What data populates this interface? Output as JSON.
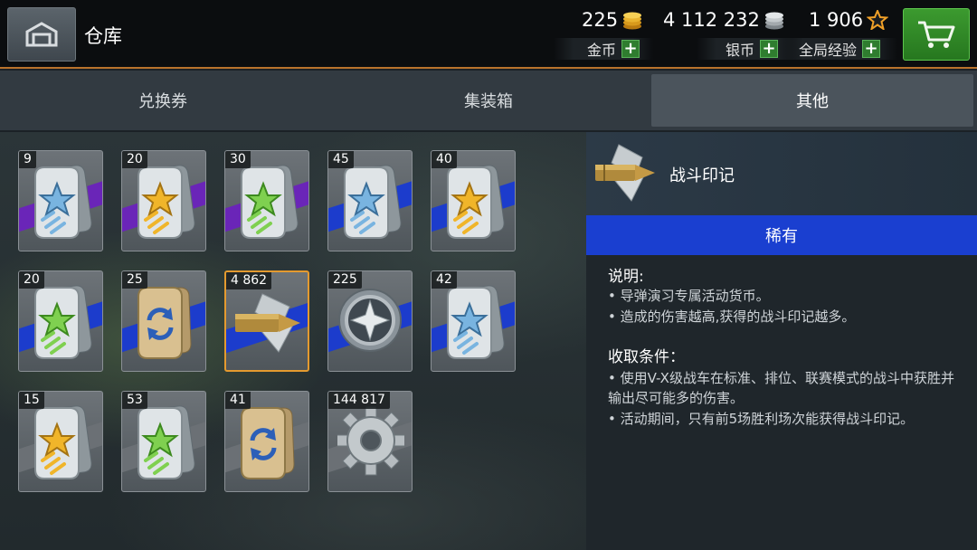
{
  "header": {
    "title": "仓库",
    "gold": {
      "value": "225",
      "label": "金币"
    },
    "silver": {
      "value": "4 112 232",
      "label": "银币"
    },
    "xp": {
      "value": "1 906",
      "label": "全局经验"
    },
    "plus": "+"
  },
  "tabs": [
    {
      "label": "兑换券",
      "active": false
    },
    {
      "label": "集装箱",
      "active": false
    },
    {
      "label": "其他",
      "active": true
    }
  ],
  "items": [
    {
      "count": "9",
      "icon": "dogtag-star-blue-icon",
      "band": "#6a25b8"
    },
    {
      "count": "20",
      "icon": "dogtag-star-yellow-icon",
      "band": "#6a25b8"
    },
    {
      "count": "30",
      "icon": "dogtag-star-green-icon",
      "band": "#6a25b8"
    },
    {
      "count": "45",
      "icon": "dogtag-star-blue-icon",
      "band": "#1c3ccc"
    },
    {
      "count": "40",
      "icon": "dogtag-star-yellow-icon",
      "band": "#1c3ccc"
    },
    {
      "count": "20",
      "icon": "dogtag-star-green-icon",
      "band": "#1c3ccc"
    },
    {
      "count": "25",
      "icon": "dogtag-exchange-icon",
      "band": "#1c3ccc"
    },
    {
      "count": "4 862",
      "icon": "battle-mark-shell-icon",
      "band": "#1c3ccc"
    },
    {
      "count": "225",
      "icon": "star-medal-icon",
      "band": "#1c3ccc"
    },
    {
      "count": "42",
      "icon": "dogtag-star-blue-icon",
      "band": "#1c3ccc"
    },
    {
      "count": "15",
      "icon": "dogtag-star-yellow-icon",
      "band": "#6b7075"
    },
    {
      "count": "53",
      "icon": "dogtag-star-green-icon",
      "band": "#6b7075"
    },
    {
      "count": "41",
      "icon": "dogtag-exchange-icon",
      "band": "#6b7075"
    },
    {
      "count": "144 817",
      "icon": "gear-icon",
      "band": "#6b7075"
    }
  ],
  "detail": {
    "name": "战斗印记",
    "rarity": "稀有",
    "desc_title": "说明:",
    "desc_lines": [
      "• 导弹演习专属活动货币。",
      "• 造成的伤害越高,获得的战斗印记越多。"
    ],
    "cond_title": "收取条件：",
    "cond_lines": [
      "• 使用V-X级战车在标准、排位、联赛模式的战斗中获胜并输出尽可能多的伤害。",
      "• 活动期间，只有前5场胜利场次能获得战斗印记。"
    ]
  },
  "colors": {
    "accent_orange": "#e49a2f",
    "rarity_blue": "#1a3fd0",
    "cart_green": "#2f8a26"
  }
}
